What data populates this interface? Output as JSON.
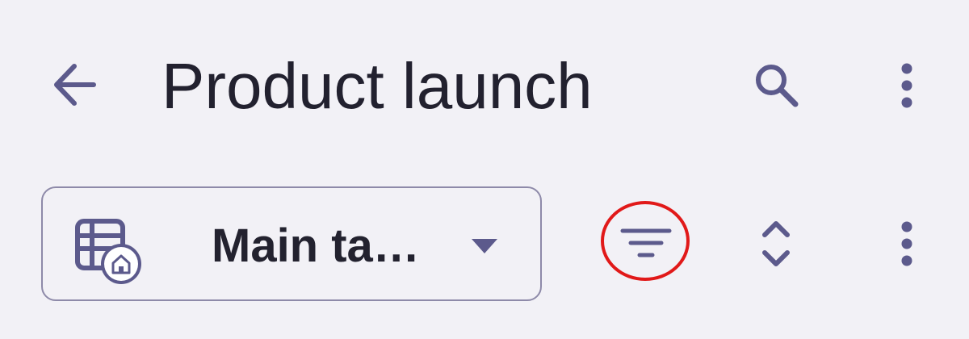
{
  "header": {
    "title": "Product launch",
    "icons": {
      "back": "arrow-back-icon",
      "search": "search-icon",
      "more": "more-vert-icon"
    }
  },
  "toolbar": {
    "table_selector": {
      "label": "Main ta…",
      "icon": "table-home-icon",
      "dropdown_icon": "caret-down-icon"
    },
    "filter_icon": "filter-icon",
    "sort_icon": "unfold-more-icon",
    "more_icon": "more-vert-icon",
    "highlight": "filter-icon"
  },
  "colors": {
    "background": "#f2f1f6",
    "icon": "#5c5a8c",
    "text": "#22212f",
    "border": "#8e8aa9",
    "highlight_ring": "#e11919"
  }
}
